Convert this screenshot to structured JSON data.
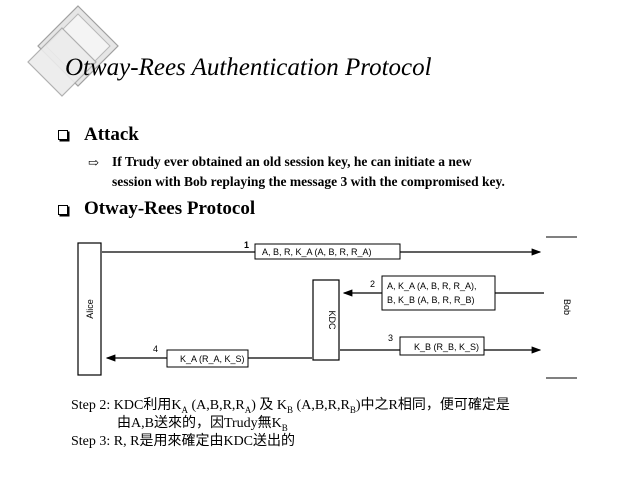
{
  "title": "Otway-Rees Authentication Protocol",
  "colors": {
    "text": "#000000",
    "decoration_fill": "#e6e6e6",
    "decoration_stroke": "#a0a0a0"
  },
  "icons": {
    "bullet": "square-bullet-icon",
    "sub_bullet": "arrow-bullet-icon"
  },
  "sections": [
    {
      "heading": "Attack",
      "items": [
        {
          "line1": "If Trudy ever obtained an old session key, he can initiate a new",
          "line2": "session with Bob replaying the message 3 with the compromised key."
        }
      ]
    },
    {
      "heading": "Otway-Rees Protocol"
    }
  ],
  "diagram": {
    "entities": {
      "alice": "Alice",
      "kdc": "KDC",
      "bob": "Bob"
    },
    "messages": [
      {
        "number": "1",
        "content": "A, B, R, K_A (A, B, R, R_A)"
      },
      {
        "number": "2",
        "line1": "A, K_A (A, B, R, R_A),",
        "line2": "B, K_B (A, B, R, R_B)"
      },
      {
        "number": "3",
        "content": "K_B (R_B, K_S)"
      },
      {
        "number": "4",
        "content": "K_A (R_A, K_S)"
      }
    ]
  },
  "notes": {
    "step2": {
      "prefix": "Step 2: KDC利用K",
      "sub1": "A",
      "part2": " (A,B,R,R",
      "sub2": "A",
      "part3": ") 及 K",
      "sub3": "B",
      "part4": " (A,B,R,R",
      "sub4": "B",
      "part5": ")中之R相同，便可確定是",
      "line2_text": "由A,B送來的，因Trudy無K",
      "line2_sub": "B"
    },
    "step3": "Step 3: R, R是用來確定由KDC送出的"
  }
}
